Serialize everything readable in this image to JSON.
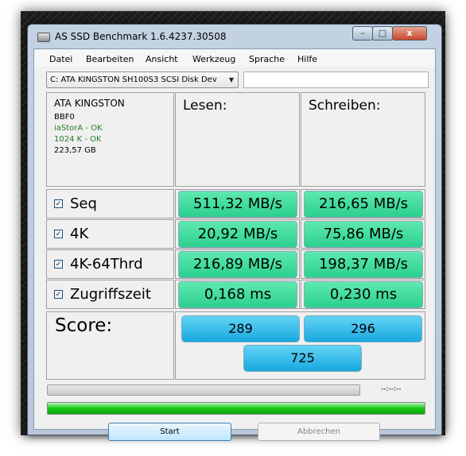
{
  "window": {
    "title": "AS SSD Benchmark 1.6.4237.30508",
    "controls": {
      "minimize": "–",
      "maximize": "□",
      "close": "x"
    }
  },
  "menu": [
    "Datei",
    "Bearbeiten",
    "Ansicht",
    "Werkzeug",
    "Sprache",
    "Hilfe"
  ],
  "drive_select": {
    "value": "C: ATA KINGSTON SH100S3 SCSI Disk Dev",
    "arrow": "▼"
  },
  "drive_info": {
    "model": "ATA KINGSTON",
    "firmware": "BBF0",
    "driver_status": "iaStorA - OK",
    "alignment_status": "1024 K - OK",
    "capacity": "223,57 GB"
  },
  "headers": {
    "read": "Lesen:",
    "write": "Schreiben:"
  },
  "rows": [
    {
      "label": "Seq",
      "checked": true,
      "read": "511,32 MB/s",
      "write": "216,65 MB/s"
    },
    {
      "label": "4K",
      "checked": true,
      "read": "20,92 MB/s",
      "write": "75,86 MB/s"
    },
    {
      "label": "4K-64Thrd",
      "checked": true,
      "read": "216,89 MB/s",
      "write": "198,37 MB/s"
    },
    {
      "label": "Zugriffszeit",
      "checked": true,
      "read": "0,168 ms",
      "write": "0,230 ms"
    }
  ],
  "checkmark": "✓",
  "score": {
    "label": "Score:",
    "read": "289",
    "write": "296",
    "total": "725"
  },
  "timer": "--:--:--",
  "progress": {
    "top_fraction": 0.0,
    "bottom_fraction": 1.0
  },
  "buttons": {
    "start": "Start",
    "cancel": "Abbrechen"
  },
  "colors": {
    "status_ok": "#2a7a2a",
    "result_green": "#35d695",
    "score_blue": "#29b6e8",
    "progress_green": "#13c613"
  }
}
